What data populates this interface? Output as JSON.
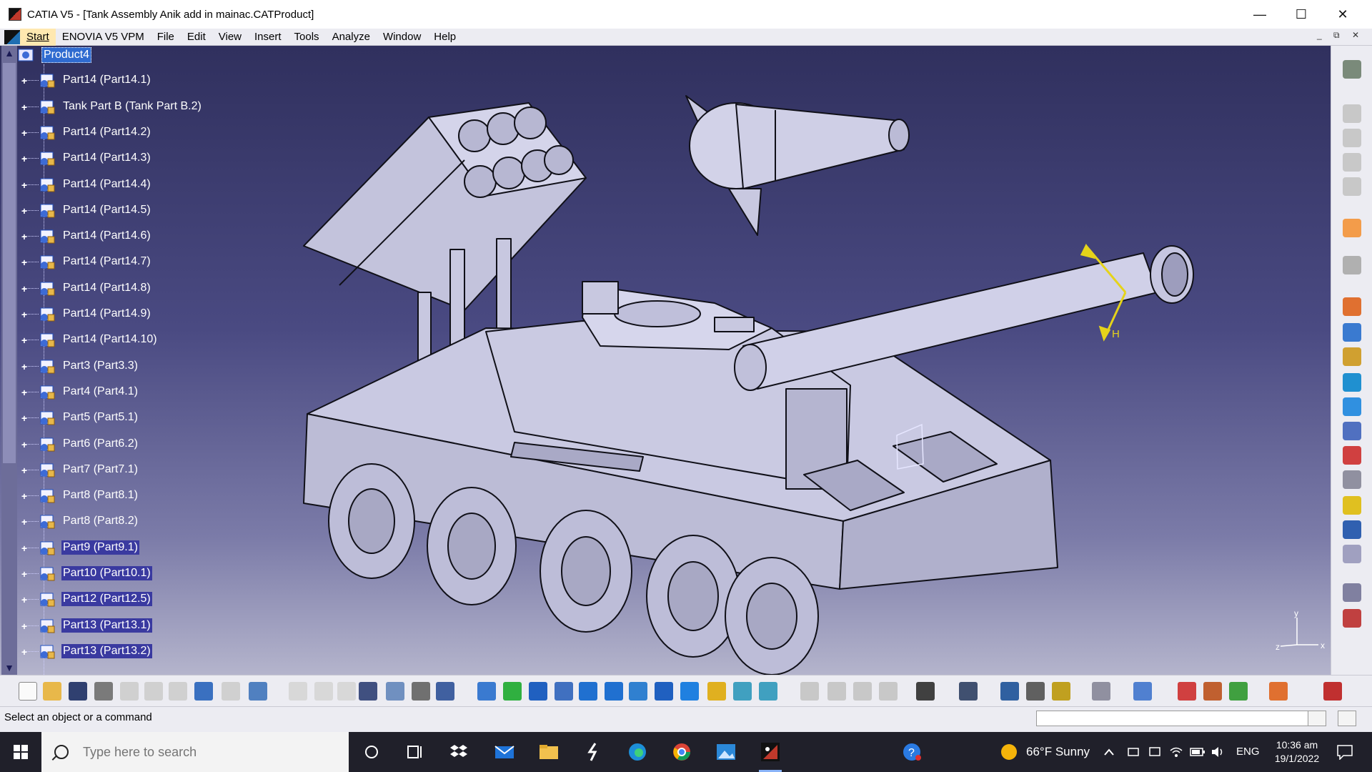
{
  "window": {
    "title": "CATIA V5 - [Tank Assembly Anik add in mainac.CATProduct]",
    "minimize": "—",
    "maximize": "☐",
    "close": "✕"
  },
  "menu": {
    "items": [
      "Start",
      "ENOVIA V5 VPM",
      "File",
      "Edit",
      "View",
      "Insert",
      "Tools",
      "Analyze",
      "Window",
      "Help"
    ],
    "mdi_min": "_",
    "mdi_restore": "⧉",
    "mdi_close": "✕"
  },
  "tree": {
    "root": "Product4",
    "items": [
      "Part14 (Part14.1)",
      "Tank Part B (Tank Part B.2)",
      "Part14 (Part14.2)",
      "Part14 (Part14.3)",
      "Part14 (Part14.4)",
      "Part14 (Part14.5)",
      "Part14 (Part14.6)",
      "Part14 (Part14.7)",
      "Part14 (Part14.8)",
      "Part14 (Part14.9)",
      "Part14 (Part14.10)",
      "Part3 (Part3.3)",
      "Part4 (Part4.1)",
      "Part5 (Part5.1)",
      "Part6 (Part6.2)",
      "Part7 (Part7.1)",
      "Part8 (Part8.1)",
      "Part8 (Part8.2)",
      "Part9 (Part9.1)",
      "Part10 (Part10.1)",
      "Part12 (Part12.5)",
      "Part13 (Part13.1)",
      "Part13 (Part13.2)"
    ]
  },
  "viewport": {
    "axis_y": "y",
    "axis_z": "z",
    "axis_x": "x",
    "compass_h": "H"
  },
  "statusbar": {
    "message": "Select an object or a command"
  },
  "taskbar": {
    "search_placeholder": "Type here to search",
    "weather": "66°F  Sunny",
    "language": "ENG",
    "time": "10:36 am",
    "date": "19/1/2022"
  },
  "colors": {
    "viewport_top": "#30305e",
    "viewport_bottom": "#b4b4cc",
    "model_fill": "#c8c8e0",
    "selection": "#3a3aa0",
    "compass": "#e5d31a"
  }
}
